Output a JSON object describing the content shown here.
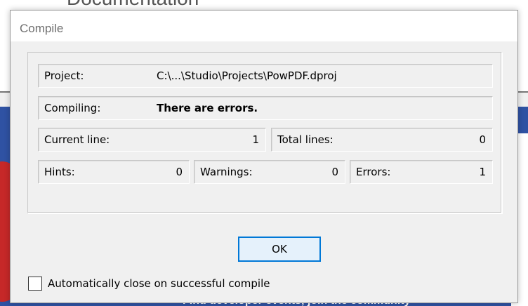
{
  "background": {
    "heading_fragment": "Documentation",
    "bottom_text_fragment": "Find developer events, join the community"
  },
  "dialog": {
    "title": "Compile",
    "project_label": "Project:",
    "project_value": "C:\\...\\Studio\\Projects\\PowPDF.dproj",
    "compiling_label": "Compiling:",
    "compiling_value": "There are errors.",
    "current_line_label": "Current line:",
    "current_line_value": "1",
    "total_lines_label": "Total lines:",
    "total_lines_value": "0",
    "hints_label": "Hints:",
    "hints_value": "0",
    "warnings_label": "Warnings:",
    "warnings_value": "0",
    "errors_label": "Errors:",
    "errors_value": "1",
    "ok_label": "OK",
    "auto_close_label": "Automatically close on successful compile",
    "auto_close_checked": false
  },
  "colors": {
    "dialog_bg": "#f0f0f0",
    "accent_focus": "#0078d7",
    "background_blue": "#2f52a3"
  }
}
